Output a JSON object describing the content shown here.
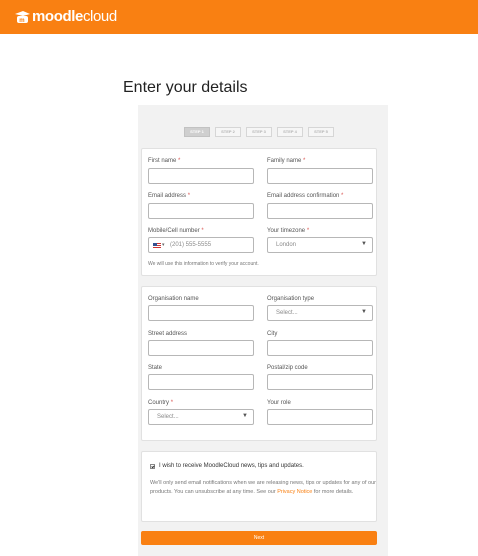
{
  "brand": {
    "logo_bold": "moodle",
    "logo_light": "cloud",
    "accent": "#f98012"
  },
  "page": {
    "title": "Enter your details"
  },
  "steps": [
    "STEP 1",
    "STEP 2",
    "STEP 3",
    "STEP 4",
    "STEP 5"
  ],
  "personal": {
    "first_name": {
      "label": "First name",
      "required": "*"
    },
    "family_name": {
      "label": "Family name",
      "required": "*"
    },
    "email": {
      "label": "Email address",
      "required": "*"
    },
    "email_confirm": {
      "label": "Email address confirmation",
      "required": "*"
    },
    "mobile": {
      "label": "Mobile/Cell number",
      "required": "*",
      "placeholder": "(201) 555-5555",
      "country_icon": "us-flag-icon"
    },
    "timezone": {
      "label": "Your timezone",
      "required": "*",
      "value": "London"
    },
    "help": "We will use this information to verify your account."
  },
  "organisation": {
    "org_name": {
      "label": "Organisation name"
    },
    "org_type": {
      "label": "Organisation type",
      "value": "Select..."
    },
    "street": {
      "label": "Street address"
    },
    "city": {
      "label": "City"
    },
    "state": {
      "label": "State"
    },
    "postal": {
      "label": "Postal/zip code"
    },
    "country": {
      "label": "Country",
      "required": "*",
      "value": "Select..."
    },
    "role": {
      "label": "Your role"
    }
  },
  "consent": {
    "checkbox_label": "I wish to receive MoodleCloud news, tips and updates.",
    "notice_before": "We'll only send email notifications when we are releasing news, tips or updates for any of our products. You can unsubscribe at any time. See our",
    "privacy_link": "Privacy Notice",
    "notice_after": "for more details."
  },
  "actions": {
    "next": "Next"
  }
}
